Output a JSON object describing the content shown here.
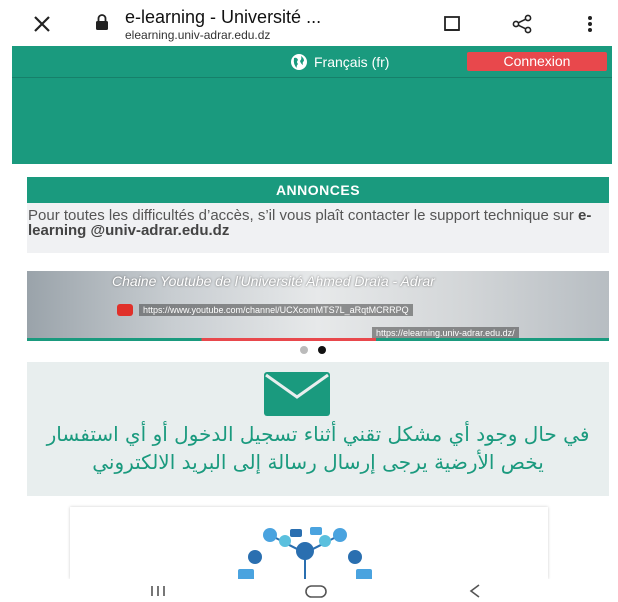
{
  "browser": {
    "title": "e-learning - Université ...",
    "url": "elearning.univ-adrar.edu.dz",
    "icons": [
      "close-icon",
      "lock-icon",
      "bookmark-icon",
      "share-icon",
      "more-vert-icon"
    ]
  },
  "header": {
    "language": "Français (fr)",
    "login": "Connexion",
    "colors": {
      "primary": "#1a9a7e",
      "login": "#e8484c"
    }
  },
  "annonces": {
    "title": "ANNONCES",
    "text_before": "Pour toutes les difficultés d’accès, s’il vous plaît contacter le support technique sur ",
    "text_bold": "e-learning @univ-adrar.edu.dz"
  },
  "banner": {
    "title": "Chaine Youtube de l'Université Ahmed Draïa - Adrar",
    "url_youtube": "https://www.youtube.com/channel/UCXcomMTS7L_aRqtMCRRPQ",
    "url_site": "https://elearning.univ-adrar.edu.dz/",
    "active_slide": 2,
    "slide_count": 2
  },
  "contact": {
    "text": "في حال وجود أي مشكل تقني أثناء تسجيل الدخول أو أي استفسار يخص الأرضية يرجى إرسال رسالة إلى البريد الالكتروني"
  },
  "navbar": {
    "icons": [
      "recent-apps-icon",
      "home-icon",
      "back-icon"
    ]
  }
}
